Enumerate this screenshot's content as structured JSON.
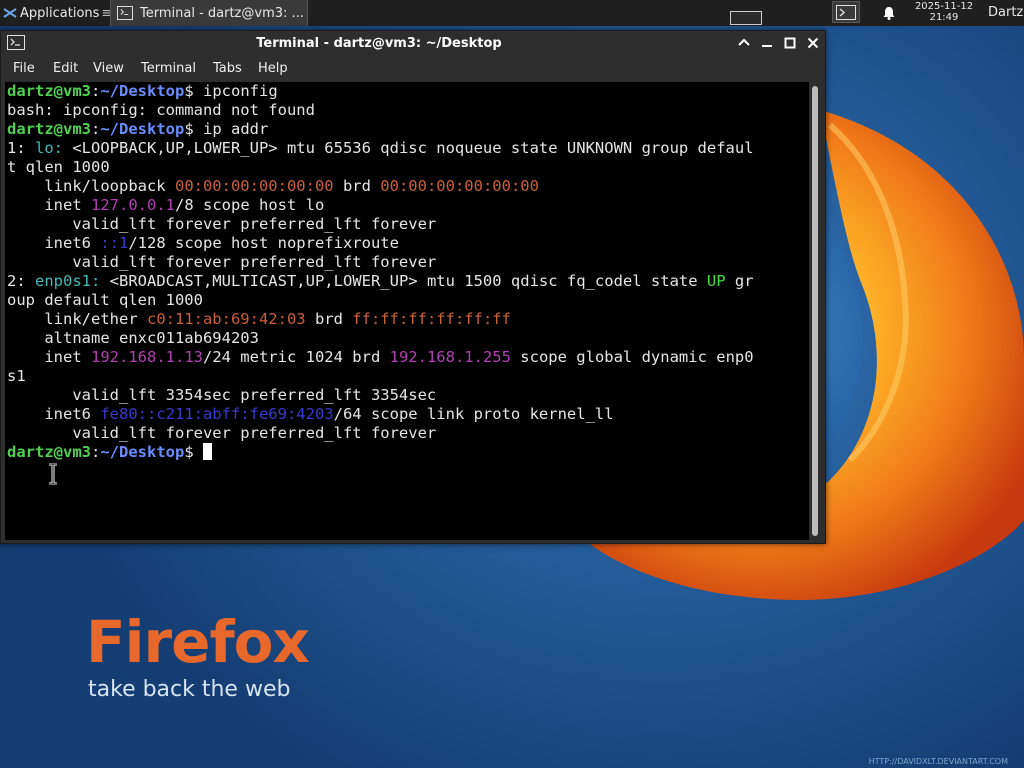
{
  "panel": {
    "applications_label": "Applications",
    "task_label": "Terminal - dartz@vm3: ...",
    "clock_date": "2025-11-12",
    "clock_time": "21:49",
    "user": "Dartz"
  },
  "window": {
    "title": "Terminal - dartz@vm3: ~/Desktop",
    "menu": [
      "File",
      "Edit",
      "View",
      "Terminal",
      "Tabs",
      "Help"
    ]
  },
  "terminal": {
    "lines": [
      [
        {
          "t": "dartz@vm3",
          "c": "g"
        },
        {
          "t": ":"
        },
        {
          "t": "~/Desktop",
          "c": "b"
        },
        {
          "t": "$ ipconfig"
        }
      ],
      [
        {
          "t": "bash: ipconfig: command not found"
        }
      ],
      [
        {
          "t": "dartz@vm3",
          "c": "g"
        },
        {
          "t": ":"
        },
        {
          "t": "~/Desktop",
          "c": "b"
        },
        {
          "t": "$ ip addr"
        }
      ],
      [
        {
          "t": "1: "
        },
        {
          "t": "lo:",
          "c": "c"
        },
        {
          "t": " <LOOPBACK,UP,LOWER_UP> mtu 65536 qdisc noqueue state UNKNOWN group defaul"
        }
      ],
      [
        {
          "t": "t qlen 1000"
        }
      ],
      [
        {
          "t": "    link/loopback "
        },
        {
          "t": "00:00:00:00:00:00",
          "c": "o"
        },
        {
          "t": " brd "
        },
        {
          "t": "00:00:00:00:00:00",
          "c": "o"
        }
      ],
      [
        {
          "t": "    inet "
        },
        {
          "t": "127.0.0.1",
          "c": "m"
        },
        {
          "t": "/8 scope host lo"
        }
      ],
      [
        {
          "t": "       valid_lft forever preferred_lft forever"
        }
      ],
      [
        {
          "t": "    inet6 "
        },
        {
          "t": "::1",
          "c": "d"
        },
        {
          "t": "/128 scope host noprefixroute"
        }
      ],
      [
        {
          "t": "       valid_lft forever preferred_lft forever"
        }
      ],
      [
        {
          "t": "2: "
        },
        {
          "t": "enp0s1:",
          "c": "c"
        },
        {
          "t": " <BROADCAST,MULTICAST,UP,LOWER_UP> mtu 1500 qdisc fq_codel state "
        },
        {
          "t": "UP",
          "c": "u"
        },
        {
          "t": " gr"
        }
      ],
      [
        {
          "t": "oup default qlen 1000"
        }
      ],
      [
        {
          "t": "    link/ether "
        },
        {
          "t": "c0:11:ab:69:42:03",
          "c": "o"
        },
        {
          "t": " brd "
        },
        {
          "t": "ff:ff:ff:ff:ff:ff",
          "c": "o"
        }
      ],
      [
        {
          "t": "    altname enxc011ab694203"
        }
      ],
      [
        {
          "t": "    inet "
        },
        {
          "t": "192.168.1.13",
          "c": "m"
        },
        {
          "t": "/24 metric 1024 brd "
        },
        {
          "t": "192.168.1.255",
          "c": "m"
        },
        {
          "t": " scope global dynamic enp0"
        }
      ],
      [
        {
          "t": "s1"
        }
      ],
      [
        {
          "t": "       valid_lft 3354sec preferred_lft 3354sec"
        }
      ],
      [
        {
          "t": "    inet6 "
        },
        {
          "t": "fe80::c211:abff:fe69:4203",
          "c": "d"
        },
        {
          "t": "/64 scope link proto kernel_ll"
        }
      ],
      [
        {
          "t": "       valid_lft forever preferred_lft forever"
        }
      ],
      [
        {
          "t": "dartz@vm3",
          "c": "g"
        },
        {
          "t": ":"
        },
        {
          "t": "~/Desktop",
          "c": "b"
        },
        {
          "t": "$ "
        },
        {
          "cursor": true
        }
      ]
    ]
  },
  "wallpaper": {
    "brand": "Firefox",
    "tagline": "take back the web",
    "credit": "HTTP://DAVIDXLT.DEVIANTART.COM"
  },
  "colors": {
    "prompt_user": "#4fd14f",
    "prompt_path": "#6a8cff",
    "interface": "#3fb8b8",
    "mac": "#c9603a",
    "ipv4": "#b23fb2",
    "ipv6": "#3a3ad0",
    "state_up": "#3ee03e",
    "firefox_orange": "#e8672a"
  },
  "icons": [
    "app-menu-icon",
    "terminal-icon",
    "workspace-icon",
    "notification-bell-icon",
    "maximize-icon",
    "minimize-icon",
    "restore-icon",
    "close-icon",
    "text-cursor-icon"
  ]
}
